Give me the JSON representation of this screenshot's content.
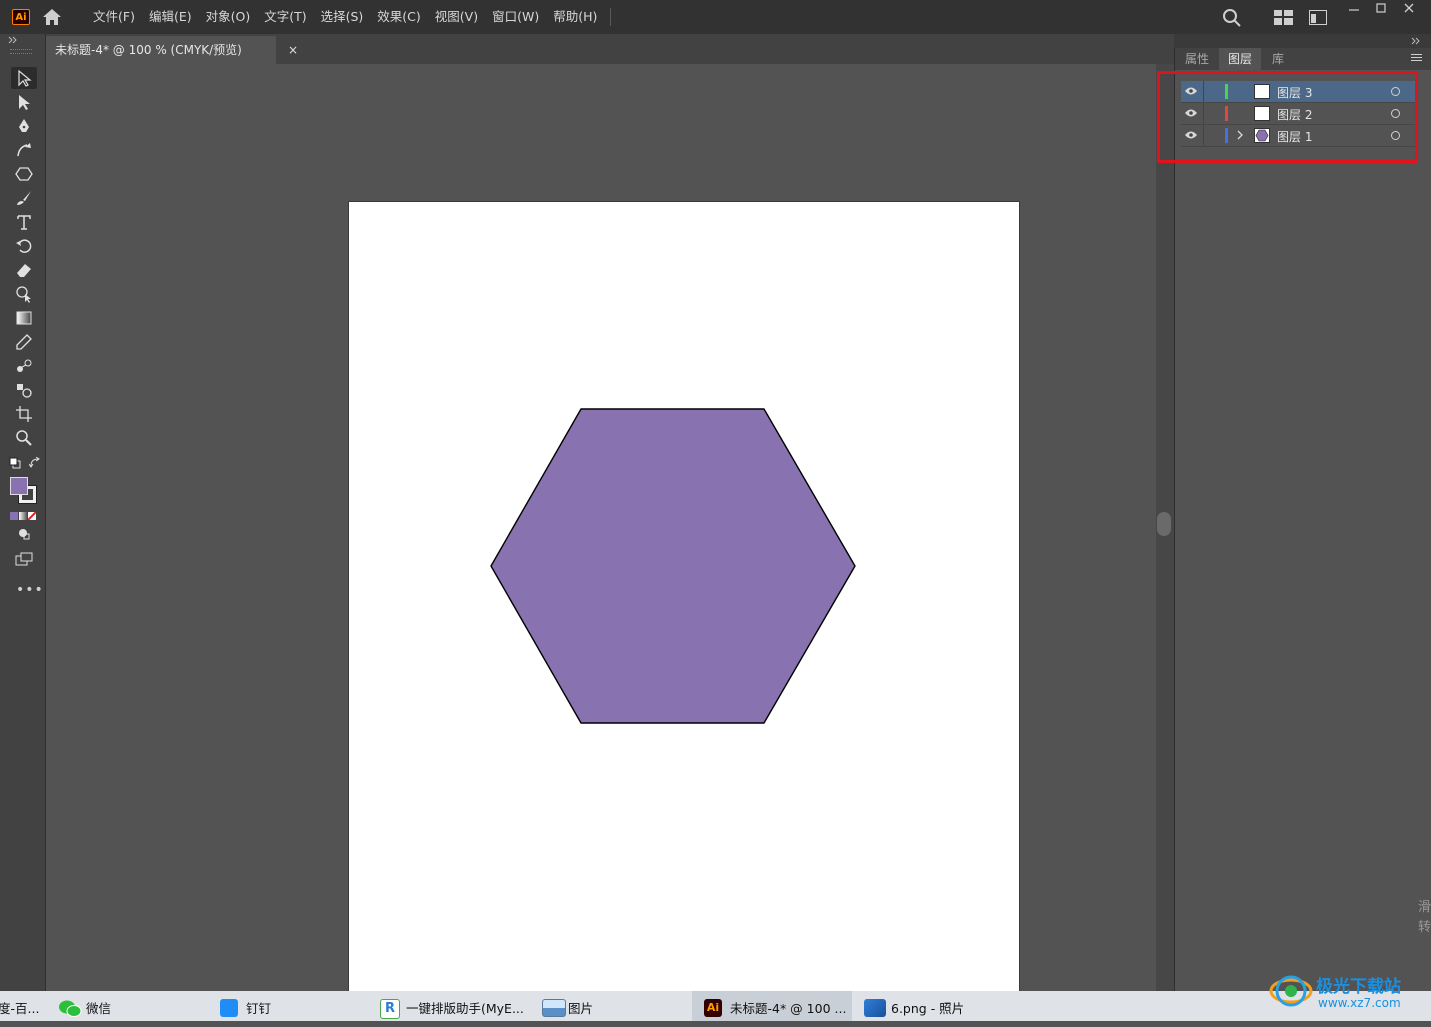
{
  "app": {
    "logo_text": "Ai",
    "menu": [
      "文件(F)",
      "编辑(E)",
      "对象(O)",
      "文字(T)",
      "选择(S)",
      "效果(C)",
      "视图(V)",
      "窗口(W)",
      "帮助(H)"
    ]
  },
  "document_tab": {
    "title": "未标题-4* @ 100 % (CMYK/预览)",
    "close": "×"
  },
  "panel": {
    "tabs": [
      "属性",
      "图层",
      "库"
    ],
    "active_tab": "图层",
    "layers": [
      {
        "name": "图层  3",
        "color": "#4fd14f",
        "selected": true,
        "has_children": false,
        "thumb": "blank"
      },
      {
        "name": "图层  2",
        "color": "#e04848",
        "selected": false,
        "has_children": false,
        "thumb": "blank"
      },
      {
        "name": "图层  1",
        "color": "#4a6fe0",
        "selected": false,
        "has_children": true,
        "thumb": "hexagon"
      }
    ]
  },
  "canvas": {
    "shape": "hexagon",
    "fill": "#8872b0",
    "stroke": "#000000"
  },
  "taskbar": {
    "items": [
      {
        "label": "度-百...",
        "active": false
      },
      {
        "label": "微信",
        "active": false
      },
      {
        "label": "钉钉",
        "active": false
      },
      {
        "label": "一键排版助手(MyE...",
        "active": false
      },
      {
        "label": "图片",
        "active": false
      },
      {
        "label": "未标题-4* @ 100 ...",
        "active": true
      },
      {
        "label": "6.png - 照片",
        "active": false
      }
    ]
  },
  "watermark": {
    "text": "极光下载站",
    "url": "www.xz7.com",
    "side_text": "滑 转"
  }
}
